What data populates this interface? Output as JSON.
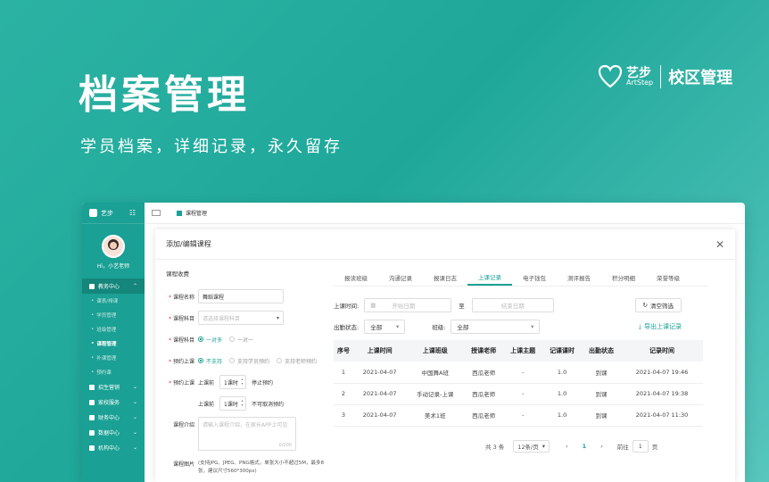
{
  "hero": {
    "title": "档案管理",
    "subtitle": "学员档案，详细记录，永久留存"
  },
  "brand": {
    "name_cn": "艺步",
    "name_en": "ArtStep",
    "campus": "校区管理"
  },
  "sidebar": {
    "logo": "艺步",
    "greeting": "Hi，小艺老师",
    "section_main": "教务中心",
    "subitems": [
      "课表/排课",
      "学员管理",
      "班级管理",
      "课程管理",
      "补课管理",
      "预约课"
    ],
    "sections": [
      "招生营销",
      "家校服务",
      "财务中心",
      "数据中心",
      "机构中心"
    ]
  },
  "topbar": {
    "title": "课程管理"
  },
  "modal": {
    "title": "添加/编辑课程",
    "form": {
      "section_title": "课程收费",
      "name_label": "课程名称",
      "name_value": "舞蹈课程",
      "subject_label": "课程科目",
      "subject_placeholder": "请选择课程科目",
      "type_label": "课程科目",
      "type_opt1": "一对多",
      "type_opt2": "一对一",
      "booking_label": "预约上课",
      "booking_opt1": "不支持",
      "booking_opt2": "支持学员预约",
      "booking_opt3": "支持老师预约",
      "booking2_label": "预约上课",
      "before_label": "上课前",
      "stop_value": "1课时",
      "stop_text": "停止预约",
      "before2_label": "上课前",
      "cancel_value": "1课时",
      "cancel_text": "不可取消预约",
      "intro_label": "课程介绍",
      "intro_placeholder": "请输入课程介绍，在家长APP上可见",
      "intro_count": "0/200",
      "image_label": "课程图片",
      "image_note": "(支持JPG、JPEG、PNG格式，单张大小不超过5M，最多8张，建议尺寸560*300px)"
    },
    "tabs": [
      "报读班级",
      "沟通记录",
      "报课日志",
      "上课记录",
      "电子钱包",
      "测评报告",
      "积分明细",
      "荣誉等级"
    ],
    "active_tab": "上课记录",
    "filters": {
      "time_label": "上课时间:",
      "start_placeholder": "开始日期",
      "to": "至",
      "end_placeholder": "结束日期",
      "clear_button": "清空筛选",
      "status_label": "出勤状态:",
      "status_value": "全部",
      "class_label": "班级:",
      "class_value": "全部",
      "export": "导出上课记录"
    },
    "table": {
      "headers": [
        "序号",
        "上课时间",
        "上课班级",
        "授课老师",
        "上课主题",
        "记课课时",
        "出勤状态",
        "记录时间"
      ],
      "rows": [
        [
          "1",
          "2021-04-07",
          "中国舞A班",
          "西瓜老师",
          "-",
          "1.0",
          "到课",
          "2021-04-07 19:46"
        ],
        [
          "2",
          "2021-04-07",
          "手动记录-上课",
          "西瓜老师",
          "-",
          "1.0",
          "到课",
          "2021-04-07 19:38"
        ],
        [
          "3",
          "2021-04-07",
          "美术1班",
          "西瓜老师",
          "-",
          "1.0",
          "到课",
          "2021-04-07 11:30"
        ]
      ]
    },
    "pager": {
      "total": "共 3 条",
      "size": "12条/页",
      "current": "1",
      "goto": "前往",
      "goto_value": "1",
      "page_unit": "页"
    }
  },
  "colors": {
    "accent": "#1aa094",
    "background": "#2bb2a3"
  }
}
